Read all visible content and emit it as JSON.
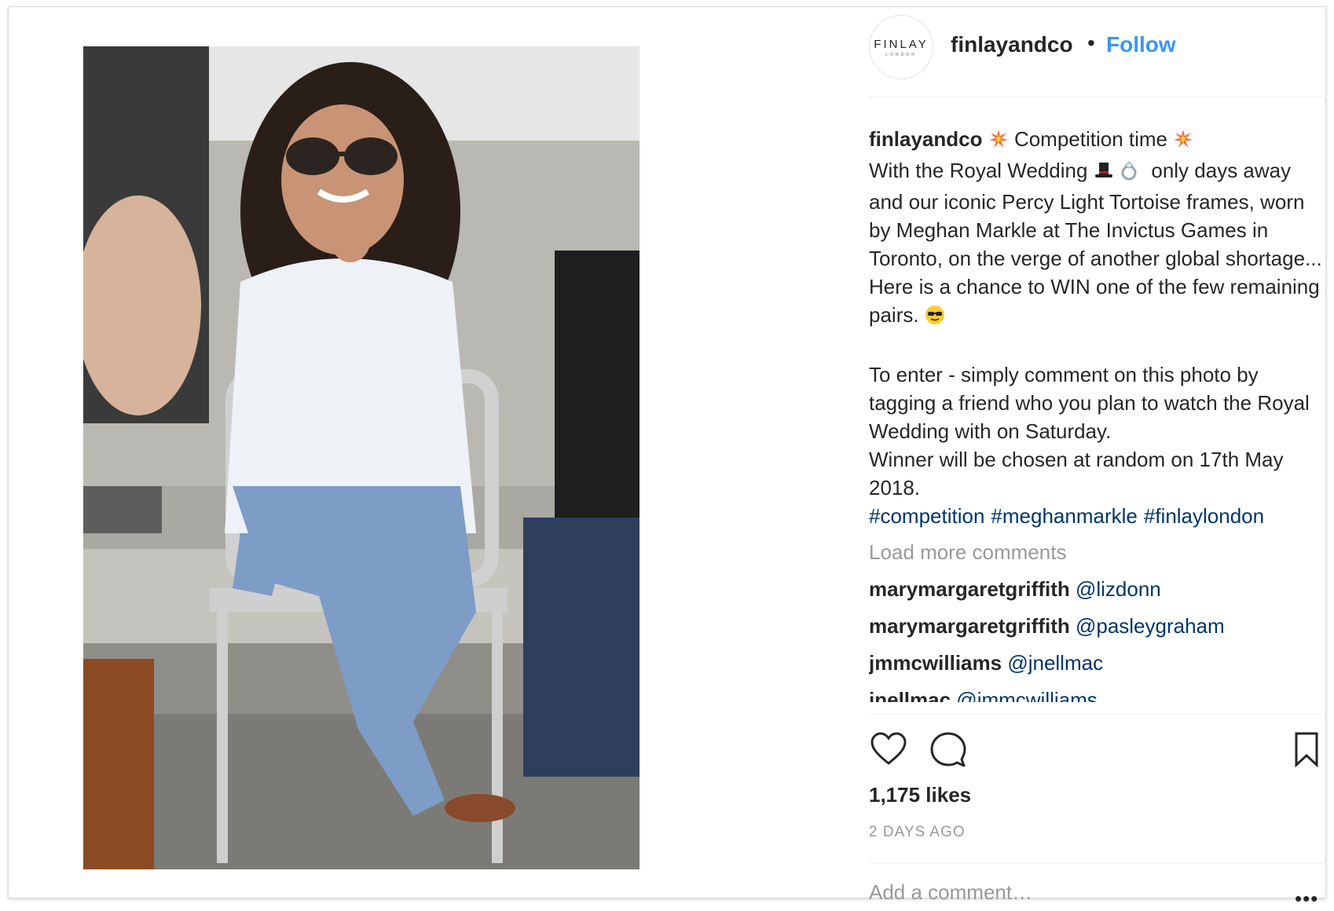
{
  "post": {
    "image_alt": "Woman in white shirt, ripped jeans and tortoise sunglasses seated on a folding chair",
    "header": {
      "avatar_brand": "FINLAY",
      "avatar_sub": "LONDON",
      "username": "finlayandco",
      "dot": "•",
      "follow_label": "Follow"
    },
    "caption": {
      "username": "finlayandco",
      "line1": " Competition time ",
      "line2_a": "With the Royal Wedding ",
      "line2_b": "  only days away and our iconic Percy Light Tortoise frames, worn by Meghan Markle at The Invictus Games in Toronto, on the verge of another global shortage... Here is a chance to WIN one of the few remaining pairs. ",
      "paragraph2": "To enter - simply comment on this photo by tagging a friend who you plan to watch the Royal Wedding with on Saturday.\nWinner will be chosen at random on 17th May 2018."
    },
    "hashtags": [
      "#competition",
      "#meghanmarkle",
      "#finlaylondon"
    ],
    "load_more_label": "Load more comments",
    "comments": [
      {
        "user": "marymargaretgriffith",
        "text": "@lizdonn"
      },
      {
        "user": "marymargaretgriffith",
        "text": "@pasleygraham"
      },
      {
        "user": "jmmcwilliams",
        "text": "@jnellmac"
      },
      {
        "user": "jnellmac",
        "text": "@jmmcwilliams"
      }
    ],
    "likes": "1,175 likes",
    "timestamp": "2 DAYS AGO",
    "add_comment_placeholder": "Add a comment…",
    "more_label": "•••"
  },
  "icons": {
    "like": "heart-icon",
    "comment": "comment-bubble-icon",
    "save": "bookmark-icon",
    "sparkle": "collision-emoji-icon",
    "tophat": "top-hat-emoji-icon",
    "ring": "ring-emoji-icon",
    "sunglasses": "sunglasses-emoji-icon"
  },
  "colors": {
    "link_blue": "#3897f0",
    "hashtag_blue": "#003569",
    "muted": "#999999",
    "text": "#262626"
  }
}
